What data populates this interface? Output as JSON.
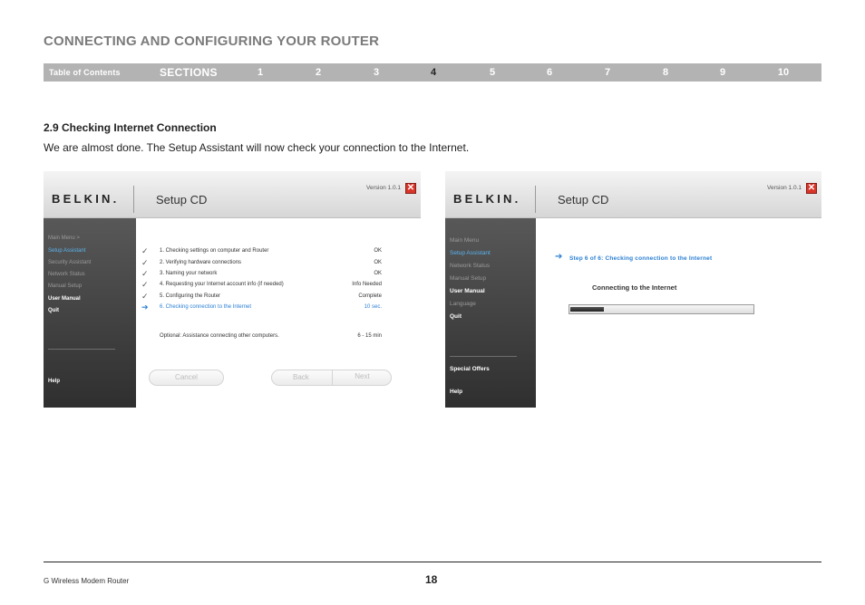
{
  "chapter_title": "CONNECTING AND CONFIGURING YOUR ROUTER",
  "nav": {
    "toc": "Table of Contents",
    "sections": "SECTIONS",
    "numbers": [
      "1",
      "2",
      "3",
      "4",
      "5",
      "6",
      "7",
      "8",
      "9",
      "10"
    ],
    "active": "4"
  },
  "section_heading": "2.9 Checking Internet Connection",
  "body_text": "We are almost done. The Setup Assistant will now check your connection to the Internet.",
  "screenshot1": {
    "logo": "BELKIN.",
    "title": "Setup CD",
    "version": "Version 1.0.1",
    "close": "✕",
    "menu": [
      "Main Menu >",
      "Setup Assistant",
      "Security Assistant",
      "Network Status",
      "Manual Setup",
      "User Manual",
      "Quit"
    ],
    "help": "Help",
    "steps": [
      {
        "text": "1. Checking settings on computer and Router",
        "status": "OK",
        "icon": "check-icon"
      },
      {
        "text": "2. Verifying hardware connections",
        "status": "OK",
        "icon": "check-icon"
      },
      {
        "text": "3. Naming your network",
        "status": "OK",
        "icon": "check-icon"
      },
      {
        "text": "4. Requesting your Internet account info (if needed)",
        "status": "Info Needed",
        "icon": "check-icon"
      },
      {
        "text": "5. Configuring the Router",
        "status": "Complete",
        "icon": "check-icon"
      },
      {
        "text": "6. Checking connection to the Internet",
        "status": "10 sec.",
        "icon": "arrow-right-icon"
      }
    ],
    "optional": "Optional: Assistance connecting other computers.",
    "optional_time": "6 - 15 min",
    "buttons": {
      "cancel": "Cancel",
      "back": "Back",
      "next": "Next"
    }
  },
  "screenshot2": {
    "logo": "BELKIN.",
    "title": "Setup CD",
    "version": "Version 1.0.1",
    "close": "✕",
    "menu": [
      "Main Menu",
      "Setup Assistant",
      "Network Status",
      "Manual Setup",
      "User Manual",
      "Language",
      "Quit"
    ],
    "special_offers": "Special Offers",
    "help": "Help",
    "step": "Step 6 of 6: Checking connection to the Internet",
    "connecting": "Connecting to the Internet",
    "progress": 0.18
  },
  "footer": {
    "product": "G Wireless Modem Router",
    "page": "18"
  }
}
